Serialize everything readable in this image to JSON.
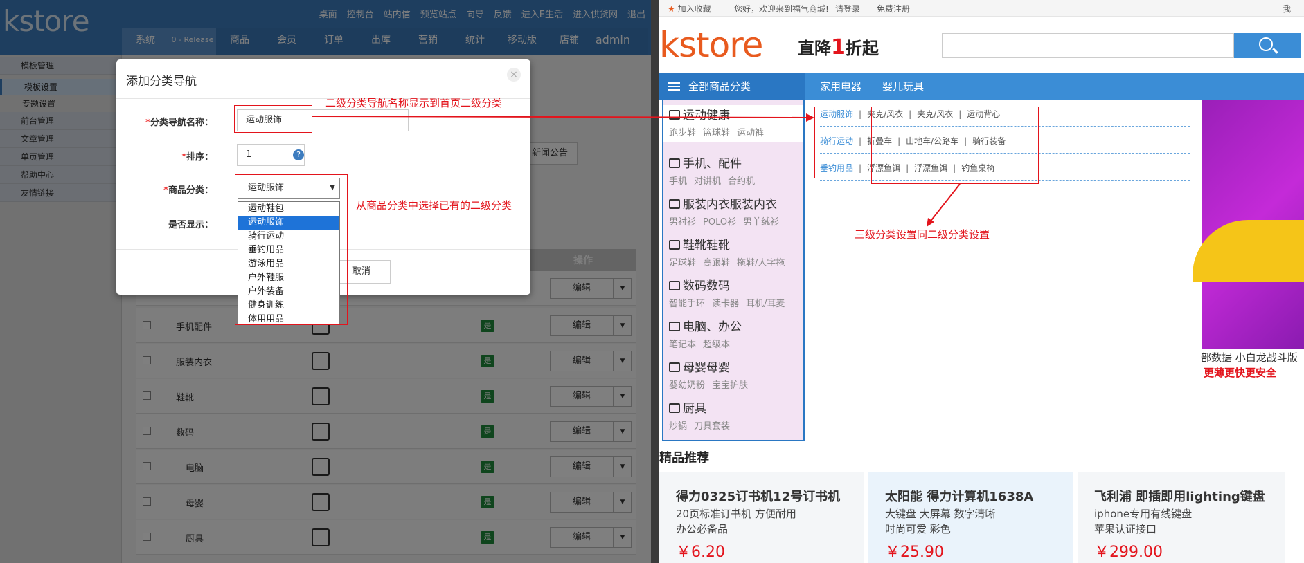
{
  "admin": {
    "logo": "kstore",
    "top_links": [
      "桌面",
      "控制台",
      "站内信",
      "预览站点",
      "向导",
      "反馈",
      "进入E生活",
      "进入供货网",
      "退出"
    ],
    "tabs": [
      "系统",
      "0 - Release",
      "商品",
      "会员",
      "订单",
      "出库",
      "营销",
      "统计",
      "移动版",
      "店铺"
    ],
    "user": "admin",
    "sidebar": {
      "groups": [
        {
          "label": "模板管理",
          "items": [
            "模板设置",
            "专题设置"
          ]
        },
        {
          "label": "前台管理",
          "items": []
        },
        {
          "label": "文章管理",
          "items": []
        },
        {
          "label": "单页管理",
          "items": []
        },
        {
          "label": "帮助中心",
          "items": []
        },
        {
          "label": "友情链接",
          "items": []
        }
      ]
    },
    "bg_tab_notice": "新闻公告",
    "table": {
      "op_header": "操作",
      "rows": [
        {
          "name": "手机配件",
          "shown": "是",
          "edit": "编辑"
        },
        {
          "name": "服装内衣",
          "shown": "是",
          "edit": "编辑"
        },
        {
          "name": "鞋靴",
          "shown": "是",
          "edit": "编辑"
        },
        {
          "name": "数码",
          "shown": "是",
          "edit": "编辑"
        },
        {
          "name": "电脑",
          "shown": "是",
          "edit": "编辑"
        },
        {
          "name": "母婴",
          "shown": "是",
          "edit": "编辑"
        },
        {
          "name": "厨具",
          "shown": "是",
          "edit": "编辑"
        }
      ]
    }
  },
  "modal": {
    "title": "添加分类导航",
    "close": "×",
    "name_label": "分类导航名称：",
    "name_value": "运动服饰",
    "sort_label": "排序：",
    "sort_value": "1",
    "cat_label": "商品分类：",
    "cat_value": "运动服饰",
    "show_label": "是否显示：",
    "cancel": "取消",
    "required_mark": "*",
    "help": "?",
    "options": [
      "运动鞋包",
      "运动服饰",
      "骑行运动",
      "垂钓用品",
      "游泳用品",
      "户外鞋服",
      "户外装备",
      "健身训练",
      "体用用品"
    ],
    "highlighted_option": "运动服饰"
  },
  "annotations": {
    "a1": "二级分类导航名称显示到首页二级分类",
    "a2": "从商品分类中选择已有的二级分类",
    "a3": "三级分类设置同二级分类设置",
    "colors": {
      "annotation": "#e3141c"
    }
  },
  "store": {
    "top_links": [
      "加入收藏",
      "您好，欢迎来到福气商城!",
      "请登录",
      "免费注册",
      "我"
    ],
    "logo": "kstore",
    "slogan_a": "直降",
    "slogan_b": "1",
    "slogan_c": "折起",
    "all_categories": "全部商品分类",
    "nav": [
      "家用电器",
      "婴儿玩具"
    ],
    "categories": [
      {
        "title": "运动健康",
        "subs": [
          "跑步鞋",
          "篮球鞋",
          "运动裤"
        ]
      },
      {
        "title": "手机、配件",
        "subs": [
          "手机",
          "对讲机",
          "合约机"
        ]
      },
      {
        "title": "服装内衣服装内衣",
        "subs": [
          "男衬衫",
          "POLO衫",
          "男羊绒衫"
        ]
      },
      {
        "title": "鞋靴鞋靴",
        "subs": [
          "足球鞋",
          "高跟鞋",
          "拖鞋/人字拖"
        ]
      },
      {
        "title": "数码数码",
        "subs": [
          "智能手环",
          "读卡器",
          "耳机/耳麦"
        ]
      },
      {
        "title": "电脑、办公",
        "subs": [
          "笔记本",
          "超级本"
        ]
      },
      {
        "title": "母婴母婴",
        "subs": [
          "婴幼奶粉",
          "宝宝护肤"
        ]
      },
      {
        "title": "厨具",
        "subs": [
          "炒锅",
          "刀具套装"
        ]
      }
    ],
    "sub_panel": [
      {
        "head": "运动服饰",
        "items": [
          "夹克/风衣",
          "夹克/风衣",
          "运动背心"
        ]
      },
      {
        "head": "骑行运动",
        "items": [
          "折叠车",
          "山地车/公路车",
          "骑行装备"
        ]
      },
      {
        "head": "垂钓用品",
        "items": [
          "浮漂鱼饵",
          "浮漂鱼饵",
          "钓鱼桌椅"
        ]
      }
    ],
    "banner_text_1": "部数据 小白龙战斗版",
    "banner_text_2": "更薄更快更安全",
    "recommend_title": "精品推荐",
    "products": [
      {
        "name": "得力0325订书机12号订书机",
        "desc1": "20页标准订书机  方便耐用",
        "desc2": "办公必备品",
        "price": "￥6.20"
      },
      {
        "name": "太阳能 得力计算机1638A",
        "desc1": "大键盘 大屏幕 数字清晰",
        "desc2": "时尚可爱 彩色",
        "price": "￥25.90"
      },
      {
        "name": "飞利浦 即插即用lighting键盘",
        "desc1": "iphone专用有线键盘",
        "desc2": "苹果认证接口",
        "price": "￥299.00"
      }
    ],
    "colors": {
      "nav": "#3b8dd6",
      "price": "#e3141c",
      "logo": "#e85a1e"
    }
  }
}
